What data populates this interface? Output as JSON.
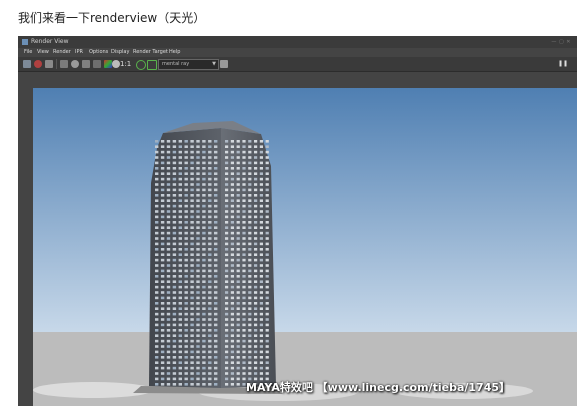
{
  "caption": "我们来看一下renderview（天光）",
  "window": {
    "title": "Render View",
    "menu": [
      "File",
      "View",
      "Render",
      "IPR",
      "Options",
      "Display",
      "Render Target",
      "Help"
    ],
    "ratio_label": "1:1",
    "renderer": "mental ray"
  },
  "watermark": "MAYA特效吧 【www.linecg.com/tieba/1745】",
  "colors": {
    "sky_top": "#4f7fb2",
    "sky_bottom": "#c7d8e9",
    "ground": "#bcbcbc",
    "building": "#5a5e66"
  },
  "icons": [
    "render-icon",
    "stop-icon",
    "snapshot-icon",
    "render-region-icon",
    "refresh-icon",
    "ipr-icon",
    "keep-image-icon",
    "rgb-channels-icon",
    "alpha-channel-icon",
    "ratio-icon",
    "green-check-icon",
    "camera-icon",
    "pause-icon"
  ]
}
